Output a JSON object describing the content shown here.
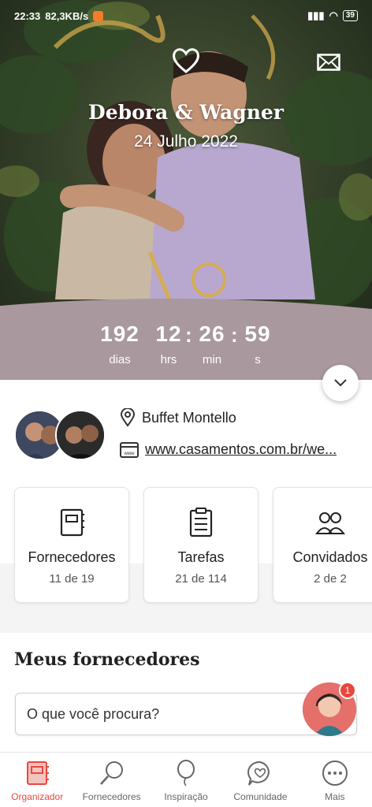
{
  "status_bar": {
    "time": "22:33",
    "speed": "82,3KB/s",
    "battery": "39"
  },
  "hero": {
    "names": "Debora & Wagner",
    "date": "24 Julho 2022"
  },
  "countdown": {
    "days": "192",
    "days_label": "dias",
    "hours": "12",
    "hours_label": "hrs",
    "minutes": "26",
    "minutes_label": "min",
    "seconds": "59",
    "seconds_label": "s",
    "separator": ":"
  },
  "info": {
    "venue": "Buffet Montello",
    "website": "www.casamentos.com.br/we..."
  },
  "cards": [
    {
      "title": "Fornecedores",
      "subtitle": "11 de 19",
      "icon": "notebook-icon"
    },
    {
      "title": "Tarefas",
      "subtitle": "21 de 114",
      "icon": "checklist-icon"
    },
    {
      "title": "Convidados",
      "subtitle": "2 de 2",
      "icon": "guests-icon"
    }
  ],
  "section": {
    "title": "Meus fornecedores",
    "search_placeholder": "O que você procura?",
    "assistant_badge": "1"
  },
  "nav": [
    {
      "label": "Organizador",
      "icon": "organizer-icon",
      "active": true
    },
    {
      "label": "Fornecedores",
      "icon": "search-icon",
      "active": false
    },
    {
      "label": "Inspiração",
      "icon": "balloon-icon",
      "active": false
    },
    {
      "label": "Comunidade",
      "icon": "chat-heart-icon",
      "active": false
    },
    {
      "label": "Mais",
      "icon": "more-icon",
      "active": false
    }
  ],
  "colors": {
    "accent": "#e8473f",
    "countdown_band": "#a9989e"
  }
}
